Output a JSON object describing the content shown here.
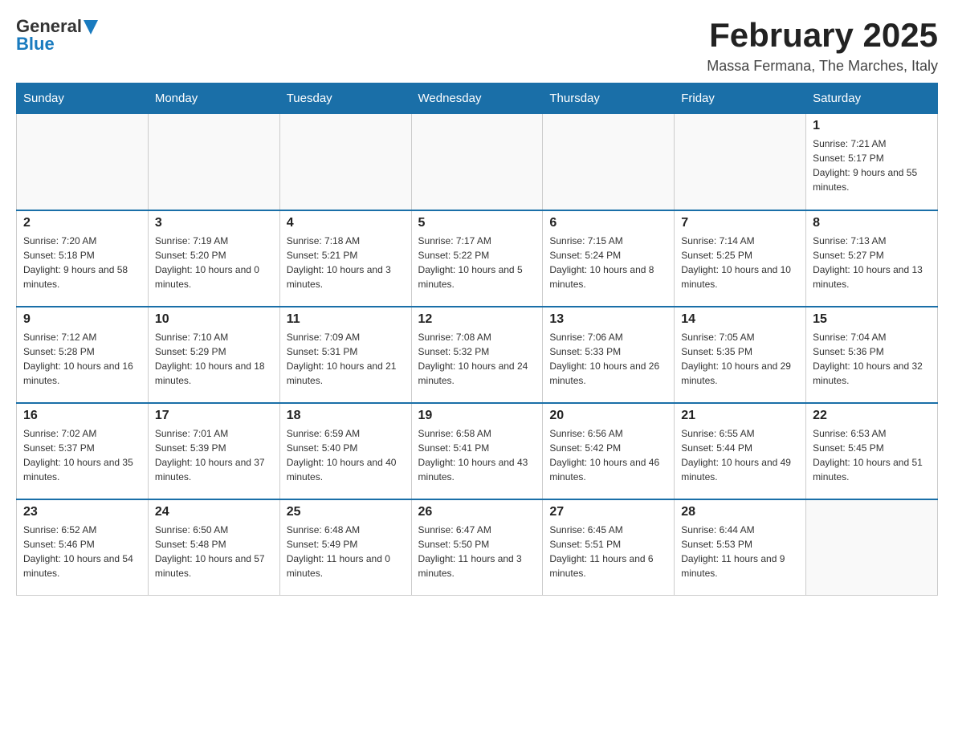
{
  "header": {
    "logo_general": "General",
    "logo_blue": "Blue",
    "month_year": "February 2025",
    "location": "Massa Fermana, The Marches, Italy"
  },
  "days_of_week": [
    "Sunday",
    "Monday",
    "Tuesday",
    "Wednesday",
    "Thursday",
    "Friday",
    "Saturday"
  ],
  "weeks": [
    [
      {
        "day": "",
        "sunrise": "",
        "sunset": "",
        "daylight": ""
      },
      {
        "day": "",
        "sunrise": "",
        "sunset": "",
        "daylight": ""
      },
      {
        "day": "",
        "sunrise": "",
        "sunset": "",
        "daylight": ""
      },
      {
        "day": "",
        "sunrise": "",
        "sunset": "",
        "daylight": ""
      },
      {
        "day": "",
        "sunrise": "",
        "sunset": "",
        "daylight": ""
      },
      {
        "day": "",
        "sunrise": "",
        "sunset": "",
        "daylight": ""
      },
      {
        "day": "1",
        "sunrise": "Sunrise: 7:21 AM",
        "sunset": "Sunset: 5:17 PM",
        "daylight": "Daylight: 9 hours and 55 minutes."
      }
    ],
    [
      {
        "day": "2",
        "sunrise": "Sunrise: 7:20 AM",
        "sunset": "Sunset: 5:18 PM",
        "daylight": "Daylight: 9 hours and 58 minutes."
      },
      {
        "day": "3",
        "sunrise": "Sunrise: 7:19 AM",
        "sunset": "Sunset: 5:20 PM",
        "daylight": "Daylight: 10 hours and 0 minutes."
      },
      {
        "day": "4",
        "sunrise": "Sunrise: 7:18 AM",
        "sunset": "Sunset: 5:21 PM",
        "daylight": "Daylight: 10 hours and 3 minutes."
      },
      {
        "day": "5",
        "sunrise": "Sunrise: 7:17 AM",
        "sunset": "Sunset: 5:22 PM",
        "daylight": "Daylight: 10 hours and 5 minutes."
      },
      {
        "day": "6",
        "sunrise": "Sunrise: 7:15 AM",
        "sunset": "Sunset: 5:24 PM",
        "daylight": "Daylight: 10 hours and 8 minutes."
      },
      {
        "day": "7",
        "sunrise": "Sunrise: 7:14 AM",
        "sunset": "Sunset: 5:25 PM",
        "daylight": "Daylight: 10 hours and 10 minutes."
      },
      {
        "day": "8",
        "sunrise": "Sunrise: 7:13 AM",
        "sunset": "Sunset: 5:27 PM",
        "daylight": "Daylight: 10 hours and 13 minutes."
      }
    ],
    [
      {
        "day": "9",
        "sunrise": "Sunrise: 7:12 AM",
        "sunset": "Sunset: 5:28 PM",
        "daylight": "Daylight: 10 hours and 16 minutes."
      },
      {
        "day": "10",
        "sunrise": "Sunrise: 7:10 AM",
        "sunset": "Sunset: 5:29 PM",
        "daylight": "Daylight: 10 hours and 18 minutes."
      },
      {
        "day": "11",
        "sunrise": "Sunrise: 7:09 AM",
        "sunset": "Sunset: 5:31 PM",
        "daylight": "Daylight: 10 hours and 21 minutes."
      },
      {
        "day": "12",
        "sunrise": "Sunrise: 7:08 AM",
        "sunset": "Sunset: 5:32 PM",
        "daylight": "Daylight: 10 hours and 24 minutes."
      },
      {
        "day": "13",
        "sunrise": "Sunrise: 7:06 AM",
        "sunset": "Sunset: 5:33 PM",
        "daylight": "Daylight: 10 hours and 26 minutes."
      },
      {
        "day": "14",
        "sunrise": "Sunrise: 7:05 AM",
        "sunset": "Sunset: 5:35 PM",
        "daylight": "Daylight: 10 hours and 29 minutes."
      },
      {
        "day": "15",
        "sunrise": "Sunrise: 7:04 AM",
        "sunset": "Sunset: 5:36 PM",
        "daylight": "Daylight: 10 hours and 32 minutes."
      }
    ],
    [
      {
        "day": "16",
        "sunrise": "Sunrise: 7:02 AM",
        "sunset": "Sunset: 5:37 PM",
        "daylight": "Daylight: 10 hours and 35 minutes."
      },
      {
        "day": "17",
        "sunrise": "Sunrise: 7:01 AM",
        "sunset": "Sunset: 5:39 PM",
        "daylight": "Daylight: 10 hours and 37 minutes."
      },
      {
        "day": "18",
        "sunrise": "Sunrise: 6:59 AM",
        "sunset": "Sunset: 5:40 PM",
        "daylight": "Daylight: 10 hours and 40 minutes."
      },
      {
        "day": "19",
        "sunrise": "Sunrise: 6:58 AM",
        "sunset": "Sunset: 5:41 PM",
        "daylight": "Daylight: 10 hours and 43 minutes."
      },
      {
        "day": "20",
        "sunrise": "Sunrise: 6:56 AM",
        "sunset": "Sunset: 5:42 PM",
        "daylight": "Daylight: 10 hours and 46 minutes."
      },
      {
        "day": "21",
        "sunrise": "Sunrise: 6:55 AM",
        "sunset": "Sunset: 5:44 PM",
        "daylight": "Daylight: 10 hours and 49 minutes."
      },
      {
        "day": "22",
        "sunrise": "Sunrise: 6:53 AM",
        "sunset": "Sunset: 5:45 PM",
        "daylight": "Daylight: 10 hours and 51 minutes."
      }
    ],
    [
      {
        "day": "23",
        "sunrise": "Sunrise: 6:52 AM",
        "sunset": "Sunset: 5:46 PM",
        "daylight": "Daylight: 10 hours and 54 minutes."
      },
      {
        "day": "24",
        "sunrise": "Sunrise: 6:50 AM",
        "sunset": "Sunset: 5:48 PM",
        "daylight": "Daylight: 10 hours and 57 minutes."
      },
      {
        "day": "25",
        "sunrise": "Sunrise: 6:48 AM",
        "sunset": "Sunset: 5:49 PM",
        "daylight": "Daylight: 11 hours and 0 minutes."
      },
      {
        "day": "26",
        "sunrise": "Sunrise: 6:47 AM",
        "sunset": "Sunset: 5:50 PM",
        "daylight": "Daylight: 11 hours and 3 minutes."
      },
      {
        "day": "27",
        "sunrise": "Sunrise: 6:45 AM",
        "sunset": "Sunset: 5:51 PM",
        "daylight": "Daylight: 11 hours and 6 minutes."
      },
      {
        "day": "28",
        "sunrise": "Sunrise: 6:44 AM",
        "sunset": "Sunset: 5:53 PM",
        "daylight": "Daylight: 11 hours and 9 minutes."
      },
      {
        "day": "",
        "sunrise": "",
        "sunset": "",
        "daylight": ""
      }
    ]
  ]
}
